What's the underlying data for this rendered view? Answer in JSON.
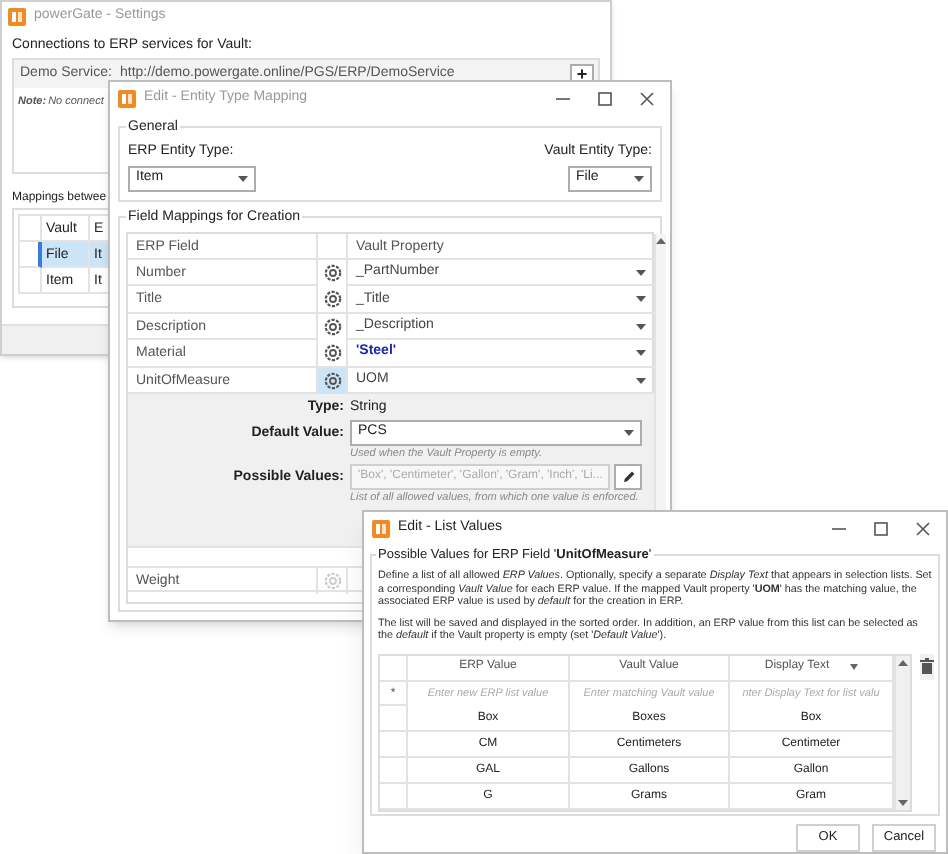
{
  "settings_window": {
    "title": "powerGate - Settings",
    "connections_label": "Connections to ERP services for Vault:",
    "service_label": "Demo Service:",
    "service_url": "http://demo.powergate.online/PGS/ERP/DemoService",
    "add_button": "+",
    "note_label": "Note:",
    "note_text": "No connect",
    "mappings_label": "Mappings betwee",
    "mappings_columns": [
      "Vault",
      "E"
    ],
    "mappings_rows": [
      {
        "vault": "File",
        "erp": "It",
        "selected": true
      },
      {
        "vault": "Item",
        "erp": "It",
        "selected": false
      }
    ]
  },
  "entity_window": {
    "title": "Edit - Entity Type Mapping",
    "general_label": "General",
    "erp_entity_type_label": "ERP Entity Type:",
    "erp_entity_type": "Item",
    "vault_entity_type_label": "Vault Entity Type:",
    "vault_entity_type": "File",
    "field_mappings_label": "Field Mappings for Creation",
    "columns": [
      "ERP Field",
      "Vault Property"
    ],
    "rows": [
      {
        "erp_field": "Number",
        "vault_property": "_PartNumber",
        "kind": "property",
        "selected": false
      },
      {
        "erp_field": "Title",
        "vault_property": "_Title",
        "kind": "property",
        "selected": false
      },
      {
        "erp_field": "Description",
        "vault_property": "_Description",
        "kind": "property",
        "selected": false
      },
      {
        "erp_field": "Material",
        "vault_property": "'Steel'",
        "kind": "literal",
        "selected": false
      },
      {
        "erp_field": "UnitOfMeasure",
        "vault_property": "UOM",
        "kind": "property",
        "selected": true
      }
    ],
    "details": {
      "type_label": "Type:",
      "type_value": "String",
      "default_label": "Default Value:",
      "default_value": "PCS",
      "default_hint": "Used when the Vault Property is empty.",
      "possible_label": "Possible Values:",
      "possible_value": "'Box', 'Centimeter', 'Gallon', 'Gram', 'Inch', 'Li...",
      "possible_hint": "List of all allowed values, from which one value is enforced."
    },
    "extra_rows": [
      {
        "erp_field": "Weight",
        "disabled": true
      }
    ]
  },
  "list_window": {
    "title": "Edit - List Values",
    "group_label": "Possible Values for ERP Field '**UnitOfMeasure**'",
    "paragraphs": [
      "Define a list of all allowed *ERP Values*. Optionally, specify a separate *Display Text* that appears in selection lists. Set a corresponding *Vault Value* for each ERP value. If the mapped Vault property '**UOM**' has the matching value, the associated ERP value is used by *default* for the creation in ERP.",
      "The list will be saved and displayed in the sorted order. In addition, an ERP value from this list can be selected as the *default* if the Vault property is empty (set '*Default Value*')."
    ],
    "columns": [
      "ERP Value",
      "Vault Value",
      "Display Text"
    ],
    "new_row": {
      "marker": "*",
      "placeholders": [
        "Enter new ERP list value",
        "Enter matching Vault value",
        "nter Display Text for list valu"
      ]
    },
    "rows": [
      {
        "erp_value": "Box",
        "vault_value": "Boxes",
        "display_text": "Box"
      },
      {
        "erp_value": "CM",
        "vault_value": "Centimeters",
        "display_text": "Centimeter"
      },
      {
        "erp_value": "GAL",
        "vault_value": "Gallons",
        "display_text": "Gallon"
      },
      {
        "erp_value": "G",
        "vault_value": "Grams",
        "display_text": "Gram"
      }
    ],
    "buttons": [
      "OK",
      "Cancel"
    ]
  }
}
